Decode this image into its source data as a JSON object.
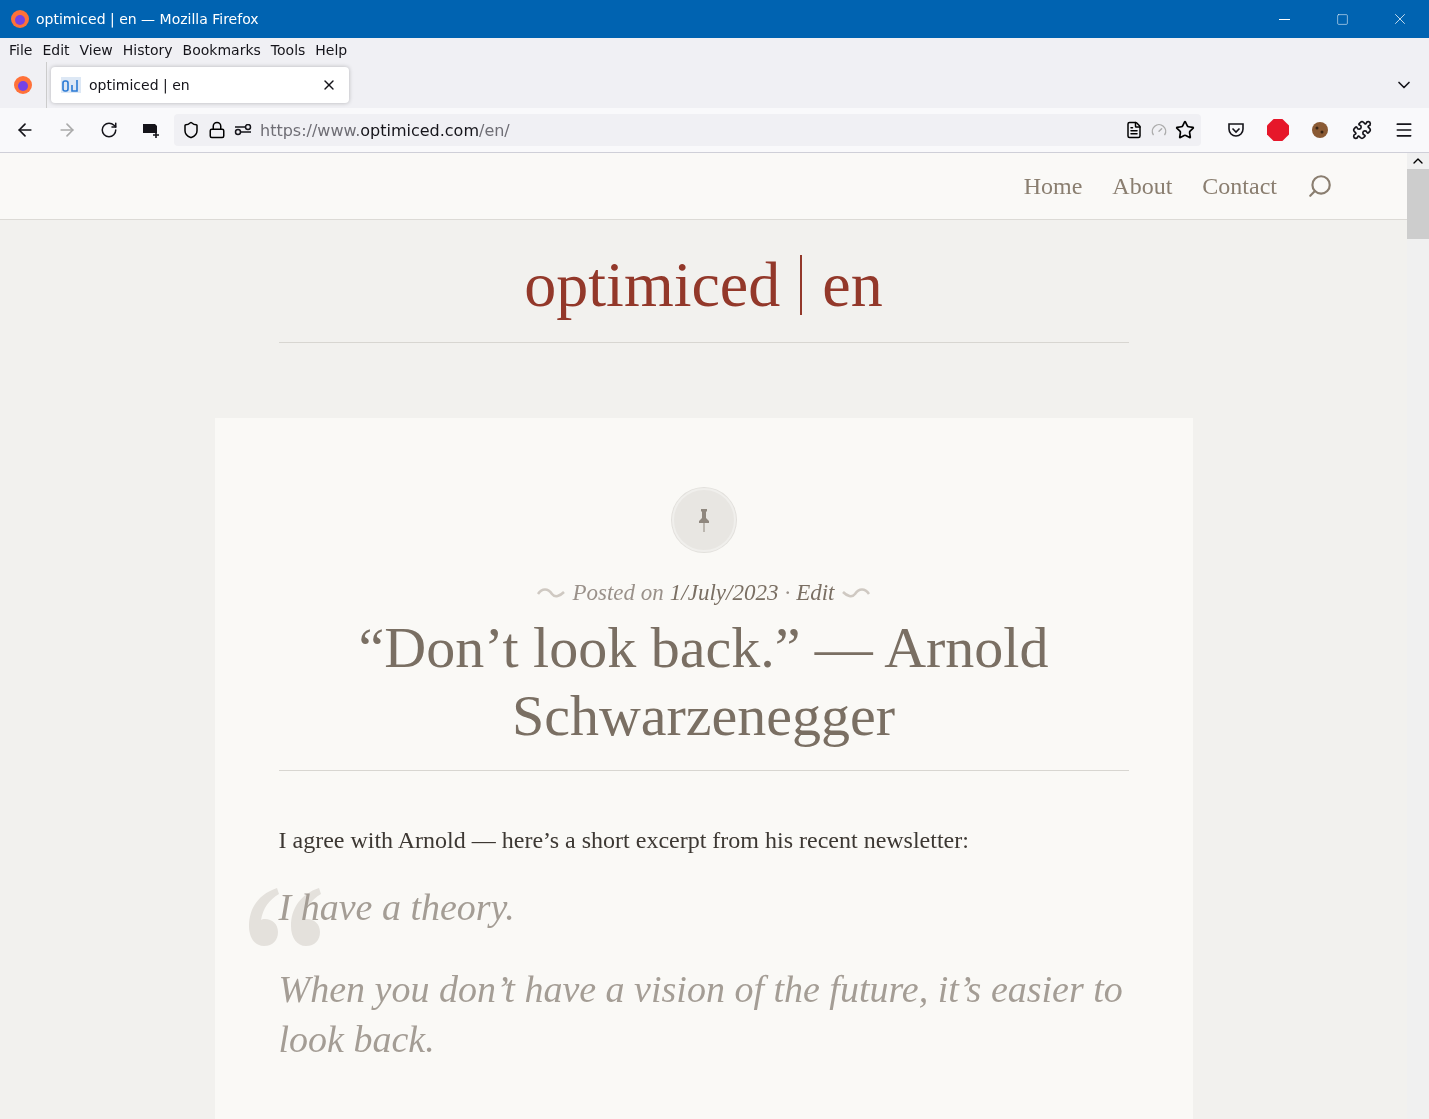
{
  "window": {
    "title": "optimiced | en — Mozilla Firefox"
  },
  "menu": [
    "File",
    "Edit",
    "View",
    "History",
    "Bookmarks",
    "Tools",
    "Help"
  ],
  "tabs": [
    {
      "label": "optimiced | en",
      "selected": true
    }
  ],
  "address": {
    "url_prefix": "https://www.",
    "url_domain": "optimiced.com",
    "url_path": "/en/"
  },
  "site_nav": [
    {
      "label": "Home",
      "selected": false
    },
    {
      "label": "About",
      "selected": false
    },
    {
      "label": "Contact",
      "selected": false
    }
  ],
  "site_title": {
    "name": "optimiced",
    "suffix": "en"
  },
  "post": {
    "meta": {
      "prefix": "Posted on",
      "date": "1/July/2023",
      "separator": "·",
      "edit": "Edit"
    },
    "title": "“Don’t look back.” — Arnold Schwarzenegger",
    "intro": "I agree with Arnold — here’s a short excerpt from his recent newsletter:",
    "quote": [
      "I have a theory.",
      "When you don’t have a vision of the future, it’s easier to look back."
    ]
  }
}
